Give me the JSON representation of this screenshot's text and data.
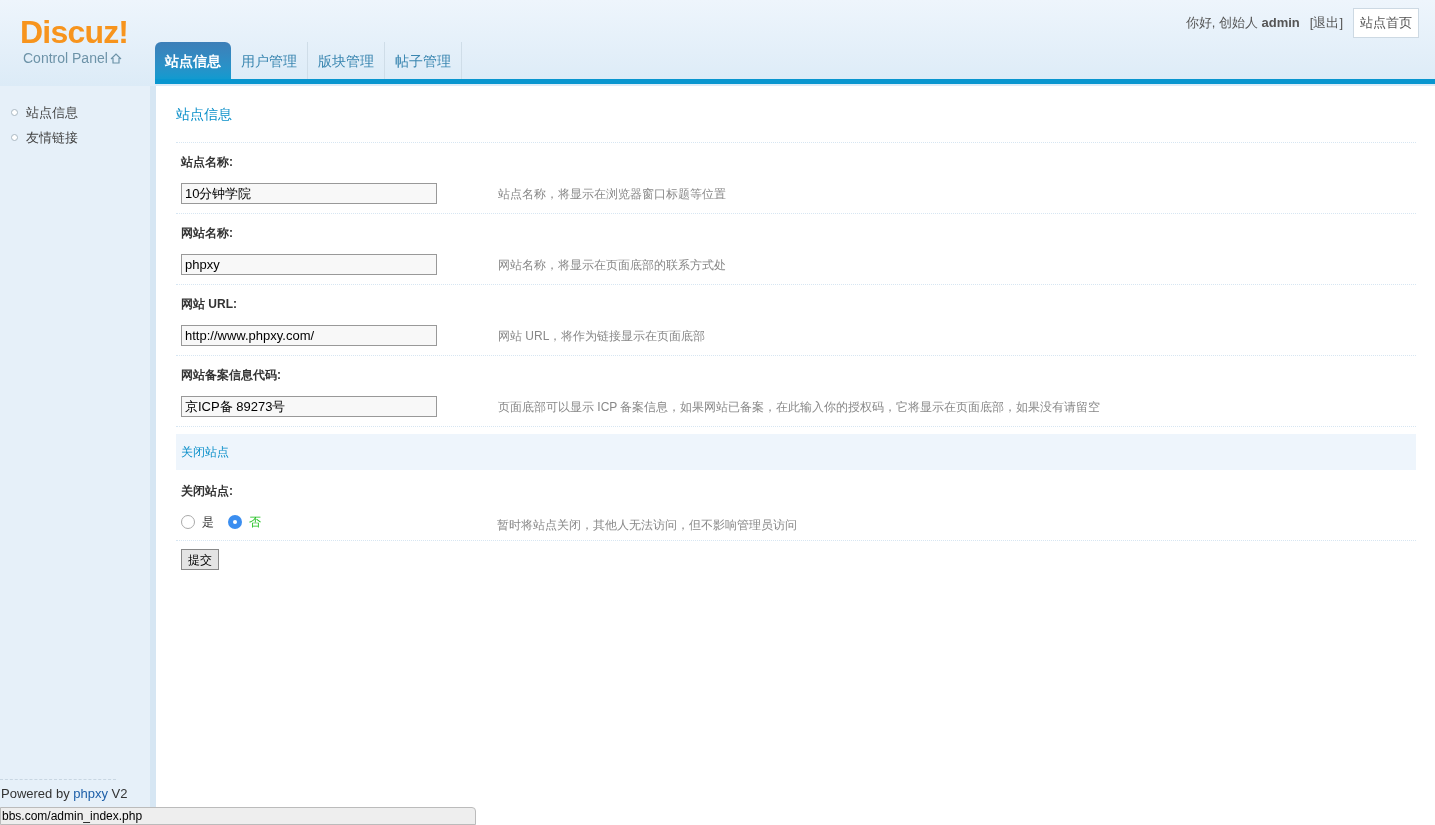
{
  "logo": {
    "brand": "Discuz!",
    "subtitle": "Control Panel"
  },
  "user_bar": {
    "greeting": "你好, 创始人 **admin**",
    "logout": "[退出]",
    "home_button": "站点首页"
  },
  "tabs": [
    {
      "label": "站点信息",
      "selected": true
    },
    {
      "label": "用户管理",
      "selected": false
    },
    {
      "label": "版块管理",
      "selected": false
    },
    {
      "label": "帖子管理",
      "selected": false
    }
  ],
  "sidebar": {
    "items": [
      {
        "label": "站点信息",
        "selected": false
      },
      {
        "label": "友情链接",
        "selected": false
      }
    ],
    "footer": {
      "prefix": "Powered by",
      "link": "phpxy",
      "suffix": "V2"
    }
  },
  "main": {
    "title": "站点信息",
    "fields": [
      {
        "label": "站点名称:",
        "value": "10分钟学院",
        "hint": "站点名称，将显示在浏览器窗口标题等位置"
      },
      {
        "label": "网站名称:",
        "value": "phpxy",
        "hint": "网站名称，将显示在页面底部的联系方式处"
      },
      {
        "label": "网站 URL:",
        "value": "http://www.phpxy.com/",
        "hint": "网站 URL，将作为链接显示在页面底部"
      },
      {
        "label": "网站备案信息代码:",
        "value": "京ICP备 89273号",
        "hint": "页面底部可以显示 ICP 备案信息，如果网站已备案，在此输入你的授权码，它将显示在页面底部，如果没有请留空"
      }
    ],
    "section": {
      "title": "关闭站点",
      "label": "关闭站点:",
      "options": [
        {
          "label": "是",
          "selected": false
        },
        {
          "label": "否",
          "selected": true
        }
      ],
      "hint": "暂时将站点关闭，其他人无法访问，但不影响管理员访问"
    },
    "submit": "提交"
  },
  "status_bar": {
    "url": "bbs.com/admin_index.php"
  }
}
